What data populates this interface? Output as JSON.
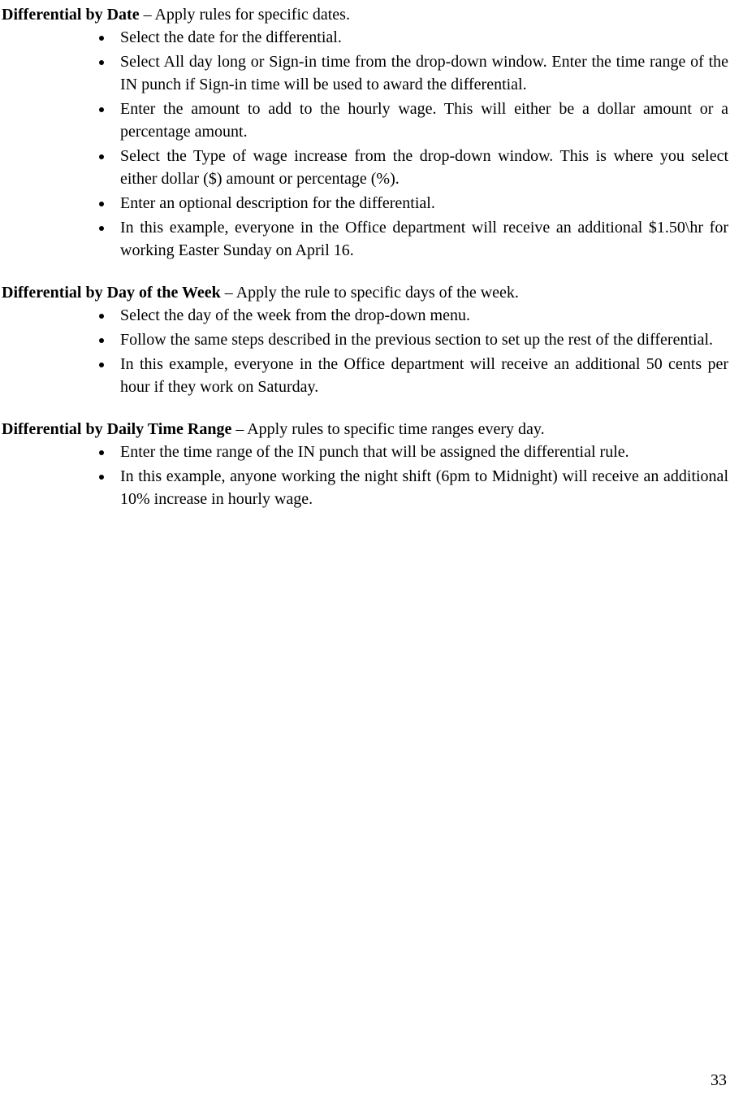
{
  "sections": [
    {
      "title": "Differential by Date",
      "desc": " – Apply rules for specific dates.",
      "items": [
        "Select the date for the differential.",
        "Select All day long or Sign-in time from the drop-down window.  Enter the time range of the IN punch if Sign-in time will be used to award the differential.",
        "Enter the amount to add to the hourly wage.  This will either be a dollar amount or a percentage amount.",
        "Select the Type of wage increase from the drop-down window.  This is where you select either dollar ($) amount or percentage (%).",
        "Enter an optional description for the differential.",
        "In this example, everyone in the Office department will receive an additional $1.50\\hr for working Easter Sunday on April 16."
      ]
    },
    {
      "title": "Differential by Day of the Week",
      "desc": " – Apply the rule to specific days of the week.",
      "items": [
        "Select the day of the week from the drop-down menu.",
        "Follow the same steps described in the previous section to set up the rest of the differential.",
        "In this example, everyone in the Office department will receive an additional 50 cents per hour if they work on Saturday."
      ]
    },
    {
      "title": "Differential by Daily Time Range",
      "desc": " – Apply rules to specific time ranges every day.",
      "items": [
        "Enter the time range of the IN punch that will be assigned the differential rule.",
        "In this example, anyone working the night shift (6pm to Midnight) will receive an additional 10% increase in hourly wage."
      ]
    }
  ],
  "pageNumber": "33"
}
